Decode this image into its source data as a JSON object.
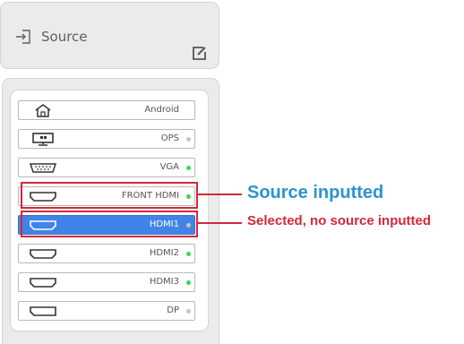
{
  "header": {
    "title": "Source",
    "icon": "source-input-icon",
    "edit_icon": "edit-icon"
  },
  "sources": [
    {
      "label": "Android",
      "icon": "home-icon",
      "status": "none"
    },
    {
      "label": "OPS",
      "icon": "ops-computer-icon",
      "status": "gray"
    },
    {
      "label": "VGA",
      "icon": "vga-port-icon",
      "status": "green"
    },
    {
      "label": "FRONT HDMI",
      "icon": "hdmi-port-icon",
      "status": "green"
    },
    {
      "label": "HDMI1",
      "icon": "hdmi-port-icon",
      "status": "gray",
      "selected": true
    },
    {
      "label": "HDMI2",
      "icon": "hdmi-port-icon",
      "status": "green"
    },
    {
      "label": "HDMI3",
      "icon": "hdmi-port-icon",
      "status": "green"
    },
    {
      "label": "DP",
      "icon": "displayport-icon",
      "status": "gray"
    }
  ],
  "annotations": {
    "inputted": "Source inputted",
    "selected_no_input": "Selected, no source inputted"
  },
  "colors": {
    "status_green": "#3dd45c",
    "status_gray": "#c4c4c4",
    "selected_blue": "#4184e8",
    "highlight_red": "#d2283b",
    "annotation_blue": "#2d93cf"
  }
}
